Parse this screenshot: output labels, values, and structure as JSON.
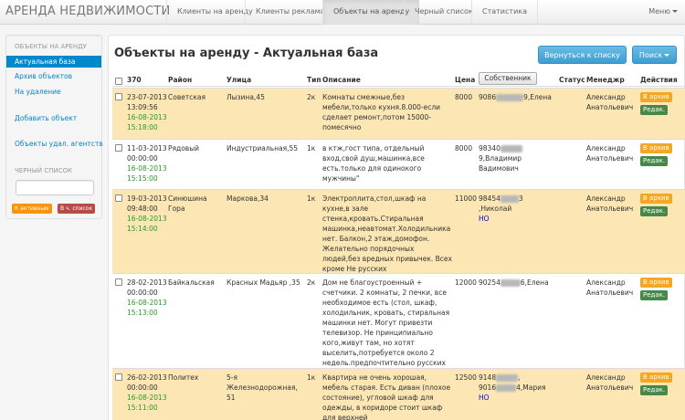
{
  "navbar": {
    "brand": "АРЕНДА НЕДВИЖИМОСТИ",
    "items": [
      "Клиенты на аренду",
      "Клиенты реклама",
      "Объекты на аренду",
      "Черный список",
      "Статистика"
    ],
    "menu_label": "Меню"
  },
  "sidebar": {
    "header": "ОБЪЕКТЫ НА АРЕНДУ",
    "active_item": "Актуальная база",
    "links": [
      "Архив объектов",
      "На удаление",
      "Добавить объект",
      "Объекты удал. агентств"
    ],
    "blacklist_header": "ЧЕРНЫЙ СПИСОК",
    "btn_active": "К активным",
    "btn_blacklist": "В ч. список",
    "colors": {
      "active": "#0088cc",
      "warning": "#f89406",
      "danger": "#b94a48"
    }
  },
  "main": {
    "title": "Объекты на аренду - Актуальная база",
    "back_button": "Вернуться к списку",
    "search_button": "Поиск"
  },
  "table": {
    "headers": {
      "count": "370",
      "district": "Район",
      "street": "Улица",
      "type": "Тип",
      "description": "Описание",
      "price": "Цена",
      "owner": "Собственник",
      "status": "Статус",
      "manager": "Менеджр",
      "actions": "Действия"
    },
    "action_archive": "В архив",
    "action_edit": "Редак.",
    "highlight_color": "#fbe6b4",
    "rows": [
      {
        "date1": "23-07-2013",
        "time1": "13:09:56",
        "date2": "16-08-2013",
        "time2": "15:18:00",
        "district": "Советская",
        "street": "Лызина,45",
        "type": "2к",
        "description": "Комнаты смежные,без мебели,только кухня.8.000-если сделает ремонт,потом 15000-помесячно",
        "price": "8000",
        "owner_pre": "9086",
        "owner_post": "9,Елена",
        "owner_extra": "",
        "manager": "Александр Анатольевич",
        "highlighted": true
      },
      {
        "date1": "11-03-2013",
        "time1": "00:00:00",
        "date2": "16-08-2013",
        "time2": "15:15:00",
        "district": "Рядовый",
        "street": "Индустриальная,55",
        "type": "1к",
        "description": "в ктж,гост типа, отдельный вход,свой душ,машинка,все есть.только для одинокого мужчины\"",
        "price": "8000",
        "owner_pre": "98340",
        "owner_post": "9,Владимир Вадимович",
        "owner_extra": "",
        "manager": "Александр Анатольевич",
        "highlighted": false
      },
      {
        "date1": "19-03-2013",
        "time1": "09:48:00",
        "date2": "16-08-2013",
        "time2": "15:14:00",
        "district": "Синюшина Гора",
        "street": "Маркова,34",
        "type": "1к",
        "description": "Электроплита,стол,шкаф на кухне,в зале стенка,кровать.Стиральная машинка,неавтомат.Холодильника нет. Балкон,2 этаж,домофон. Желательно порядочных людей,без вредных привычек. Всех кроме Не русских",
        "price": "11000",
        "owner_pre": "98454",
        "owner_post": "3 ,Николай",
        "owner_extra": "НО",
        "manager": "Александр Анатольевич",
        "highlighted": true
      },
      {
        "date1": "28-02-2013",
        "time1": "00:00:00",
        "date2": "16-08-2013",
        "time2": "15:13:00",
        "district": "Байкальская",
        "street": "Красных Мадьяр ,35",
        "type": "2к",
        "description": "Дом не благоустроенный + счетчики. 2 комнаты, 2 печки, все необходимое есть (стол, шкаф, холодильник, кровать, стиральная машинки нет. Могут привезти телевизор. Не принципиально кого,живут там, но хотят выселить,потребуется около 2 недель.предпочтительно русских",
        "price": "12000",
        "owner_pre": "90254",
        "owner_post": "6,Елена",
        "owner_extra": "",
        "manager": "Александр Анатольевич",
        "highlighted": false
      },
      {
        "date1": "26-02-2013",
        "time1": "00:00:00",
        "date2": "16-08-2013",
        "time2": "15:11:00",
        "district": "Политех",
        "street": "5-я Железнодорожная, 51",
        "type": "1к",
        "description": "Квартира не очень хорошая, мебель старая. Есть диван (плохое состояние), угловой шкаф для одежды, в коридоре стоит шкаф для верхней",
        "price": "12500",
        "owner_pre": "9148",
        "owner_post": ",",
        "owner_line2_pre": "9016",
        "owner_line2_post": "4,Мария",
        "owner_extra": "НО",
        "manager": "Александр Анатольевич",
        "highlighted": true
      }
    ]
  }
}
